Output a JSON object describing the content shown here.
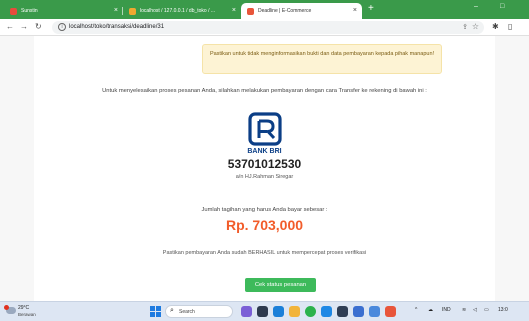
{
  "browser": {
    "tabs": [
      {
        "title": "Sunstin",
        "active": false
      },
      {
        "title": "localhost / 127.0.0.1 / db_toko / ...",
        "active": false
      },
      {
        "title": "Deadline | E-Commerce",
        "active": true
      }
    ],
    "new_tab": "+",
    "url": "localhost/toko/transaksi/deadline/31",
    "minimize": "–",
    "maximize": "□"
  },
  "page": {
    "alert": "Pastikan untuk tidak menginformasikan bukti dan data pembayaran kepada pihak manapun!",
    "instruction": "Untuk menyelesaikan proses pesanan Anda, silahkan melakukan pembayaran dengan cara Transfer ke rekening di bawah ini :",
    "bank_name": "BANK BRI",
    "account_number": "53701012530",
    "account_holder": "a/n HJ.Rahman Siregar",
    "amount_label": "Jumlah tagihan yang harus Anda bayar sebesar :",
    "amount": "Rp. 703,000",
    "confirm_text": "Pastikan pembayaran Anda sudah BERHASIL untuk mempercepat proses verifikasi",
    "status_button": "Cek status pesanan"
  },
  "taskbar": {
    "weather_temp": "29°C",
    "weather_cond": "Berawan",
    "search_label": "Search",
    "lang": "IND",
    "clock": "13:0"
  },
  "colors": {
    "tab_bar": "#3a9a4a",
    "amount": "#f25c2a",
    "button": "#3dba5b",
    "bank_blue": "#0b3e86"
  }
}
